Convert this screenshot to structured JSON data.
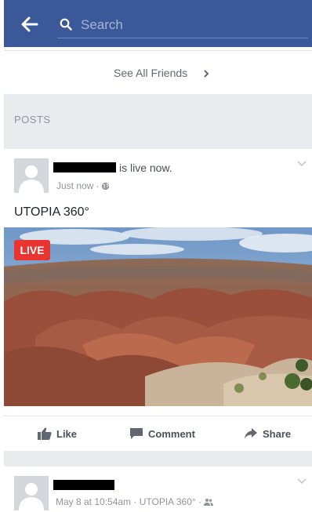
{
  "search": {
    "placeholder": "Search"
  },
  "friends": {
    "see_all_label": "See All Friends"
  },
  "section": {
    "posts_label": "POSTS"
  },
  "post1": {
    "status_text": "is live now.",
    "timestamp": "Just now",
    "separator": "·",
    "privacy_icon": "globe-icon",
    "text": "UTOPIA 360°",
    "live_badge": "LIVE",
    "actions": {
      "like": "Like",
      "comment": "Comment",
      "share": "Share"
    }
  },
  "post2": {
    "meta": "May 8 at 10:54am · UTOPIA 360° ·",
    "privacy_icon": "friends-icon"
  },
  "colors": {
    "brand": "#3b5998",
    "live": "#e9352f",
    "section_bg": "#e9ebee"
  }
}
